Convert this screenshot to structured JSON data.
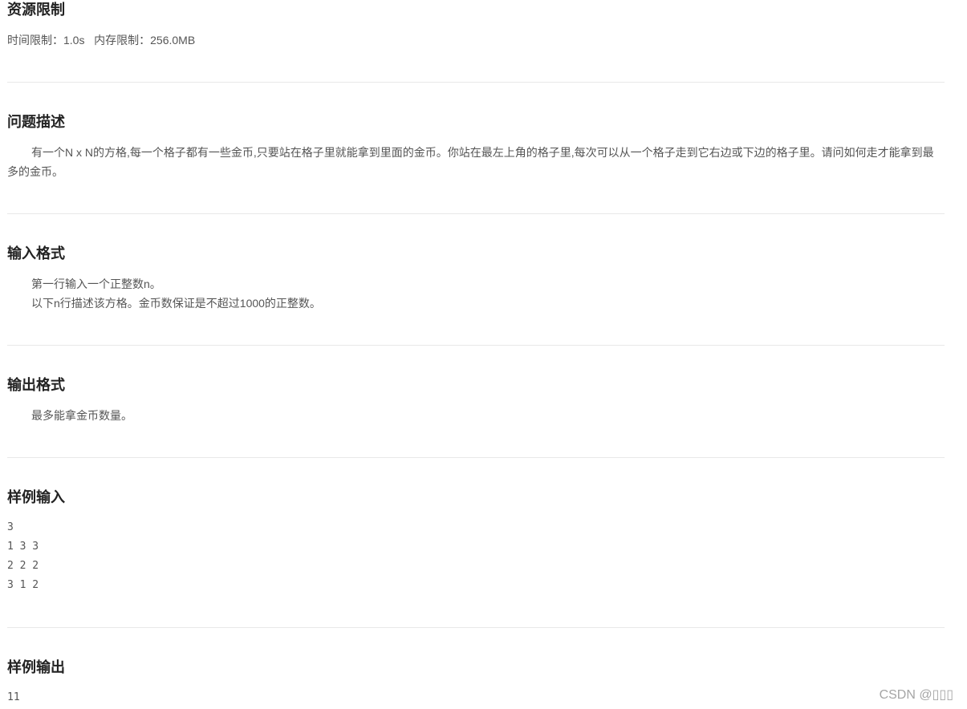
{
  "resource": {
    "heading": "资源限制",
    "limits": "时间限制：1.0s   内存限制：256.0MB"
  },
  "description": {
    "heading": "问题描述",
    "text": "有一个N x N的方格,每一个格子都有一些金币,只要站在格子里就能拿到里面的金币。你站在最左上角的格子里,每次可以从一个格子走到它右边或下边的格子里。请问如何走才能拿到最多的金币。"
  },
  "input_format": {
    "heading": "输入格式",
    "lines": [
      "第一行输入一个正整数n。",
      "以下n行描述该方格。金币数保证是不超过1000的正整数。"
    ]
  },
  "output_format": {
    "heading": "输出格式",
    "text": "最多能拿金币数量。"
  },
  "sample_input": {
    "heading": "样例输入",
    "lines": [
      "3",
      "1 3 3",
      "2 2 2",
      "3 1 2"
    ]
  },
  "sample_output": {
    "heading": "样例输出",
    "lines": [
      "11"
    ]
  },
  "watermark": "CSDN @▯▯▯"
}
